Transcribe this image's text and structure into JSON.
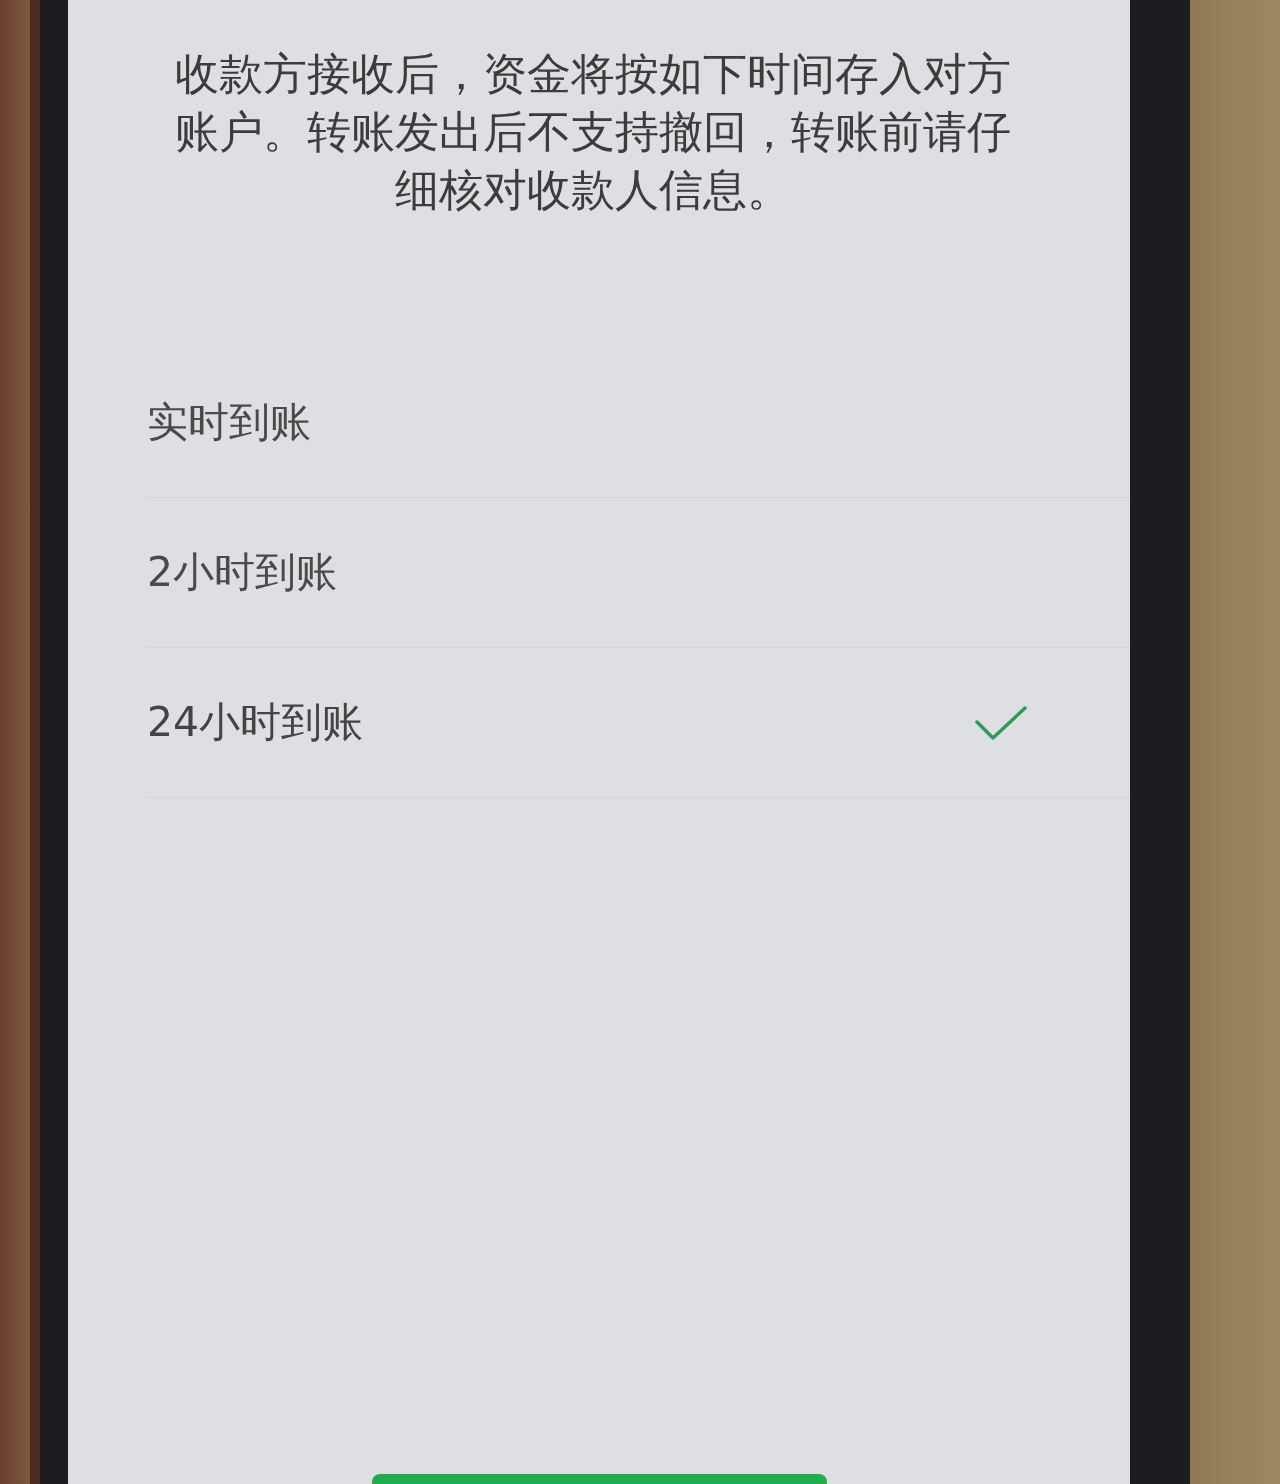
{
  "notice": "收款方接收后，资金将按如下时间存入对方账户。转账发出后不支持撤回，转账前请仔细核对收款人信息。",
  "options": [
    {
      "label": "实时到账",
      "selected": false
    },
    {
      "label": "2小时到账",
      "selected": false
    },
    {
      "label": "24小时到账",
      "selected": true
    }
  ]
}
